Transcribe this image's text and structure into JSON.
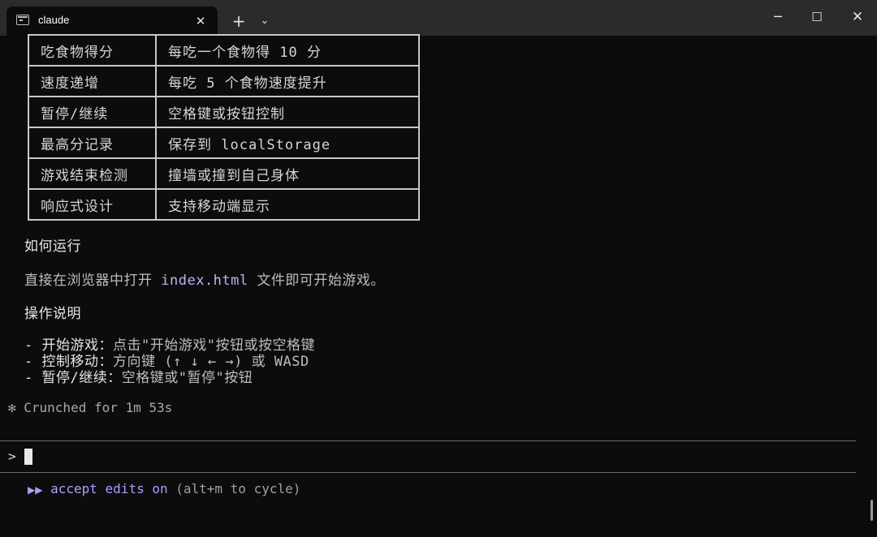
{
  "window": {
    "tab_title": "claude",
    "tab_close_glyph": "✕",
    "new_tab_glyph": "+",
    "dropdown_glyph": "⌄",
    "minimize_glyph": "─",
    "maximize_glyph": "☐",
    "close_glyph": "✕"
  },
  "table": {
    "rows": [
      {
        "feature": "吃食物得分",
        "desc": "每吃一个食物得 10 分"
      },
      {
        "feature": "速度递增",
        "desc": "每吃 5 个食物速度提升"
      },
      {
        "feature": "暂停/继续",
        "desc": "空格键或按钮控制"
      },
      {
        "feature": "最高分记录",
        "desc": "保存到 localStorage"
      },
      {
        "feature": "游戏结束检测",
        "desc": "撞墙或撞到自己身体"
      },
      {
        "feature": "响应式设计",
        "desc": "支持移动端显示"
      }
    ]
  },
  "content": {
    "how_to_run_heading": "如何运行",
    "run_prefix": "直接在浏览器中打开 ",
    "run_file": "index.html",
    "run_suffix": " 文件即可开始游戏。",
    "controls_heading": "操作说明",
    "bullets": [
      {
        "key": "- 开始游戏：",
        "text": "点击\"开始游戏\"按钮或按空格键"
      },
      {
        "key": "- 控制移动：",
        "text": "方向键 (↑ ↓ ← →) 或 WASD"
      },
      {
        "key": "- 暂停/继续：",
        "text": "空格键或\"暂停\"按钮"
      }
    ]
  },
  "status": {
    "text": "✻ Crunched for 1m 53s"
  },
  "input": {
    "prompt": ">"
  },
  "mode": {
    "icon": "▶▶",
    "label": "accept edits on",
    "hint": " (alt+m to cycle)"
  },
  "colors": {
    "background": "#0c0c0c",
    "titlebar": "#2b2b2b",
    "accent_purple": "#b19cff",
    "code_highlight": "#b9b6f5"
  }
}
